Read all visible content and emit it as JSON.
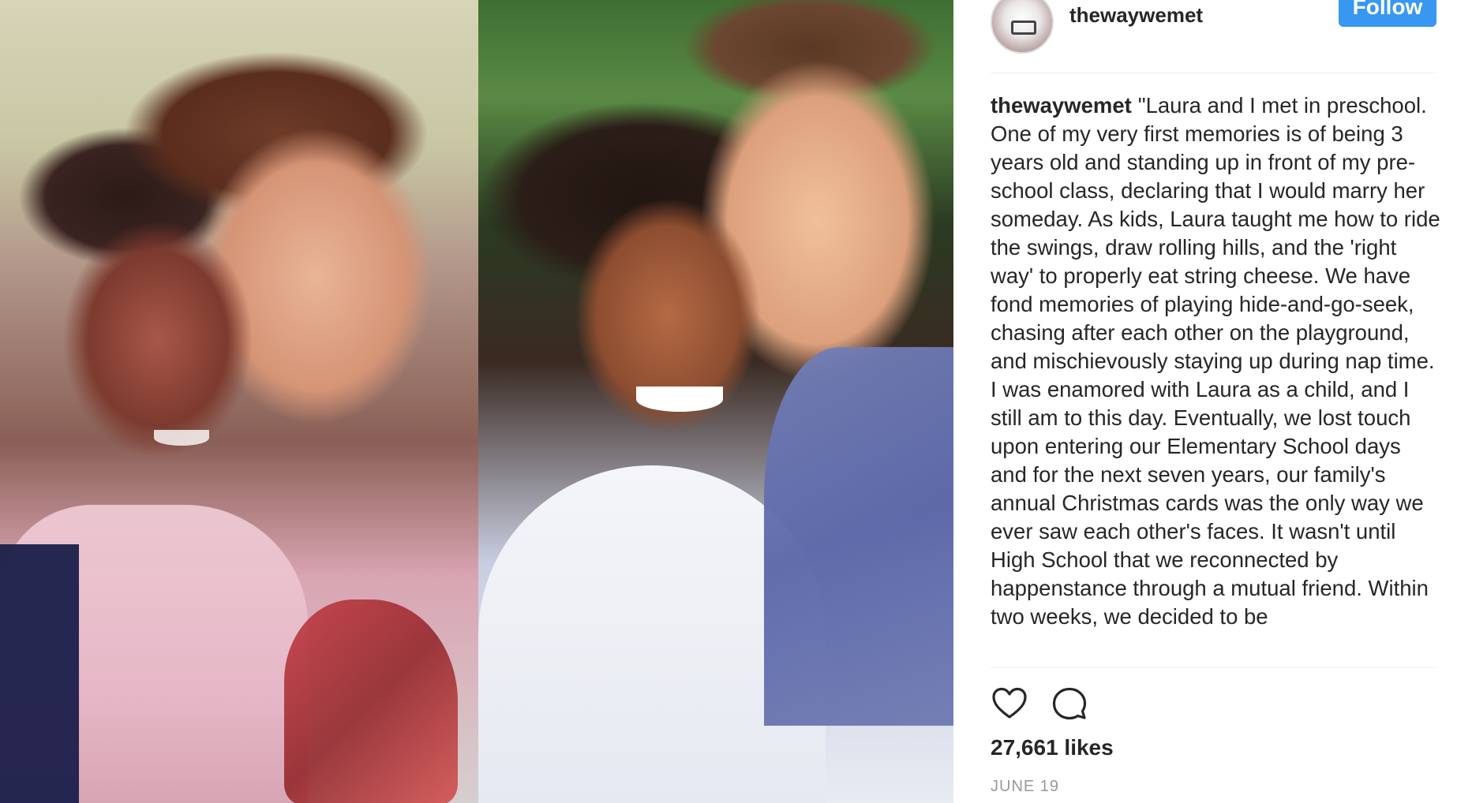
{
  "post": {
    "username": "thewaywemet",
    "follow_label": "Follow",
    "caption": {
      "username": "thewaywemet",
      "text": "\"Laura and I met in preschool. One of my very first memories is of being 3 years old and standing up in front of my pre-school class, declaring that I would marry her someday. As kids, Laura taught me how to ride the swings, draw rolling hills, and the 'right way' to properly eat string cheese. We have fond memories of playing hide-and-go-seek, chasing after each other on the playground, and mischievously staying up during nap time. I was enamored with Laura as a child, and I still am to this day. Eventually, we lost touch upon entering our Elementary School days and for the next seven years, our family's annual Christmas cards was the only way we ever saw each other's faces. It wasn't until High School that we reconnected by happenstance through a mutual friend. Within two weeks, we decided to be"
    },
    "likes": "27,661 likes",
    "date": "JUNE 19",
    "icons": {
      "like": "heart-icon",
      "comment": "comment-bubble-icon"
    },
    "colors": {
      "follow_button": "#3897f0",
      "text": "#262626",
      "date": "#999999"
    }
  }
}
